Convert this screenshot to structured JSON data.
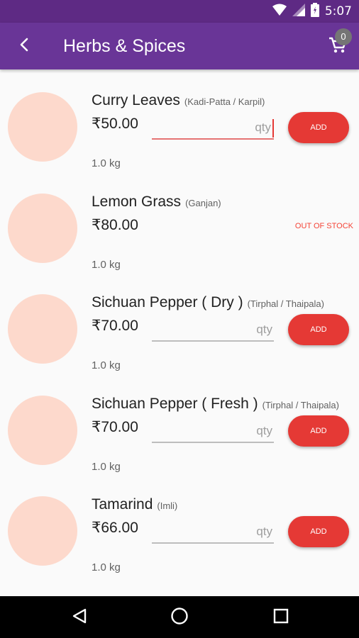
{
  "status_bar": {
    "time": "5:07"
  },
  "app_bar": {
    "title": "Herbs & Spices",
    "cart_count": "0"
  },
  "colors": {
    "primary": "#693597",
    "status_bar": "#5e2a84",
    "accent": "#e53935",
    "thumbnail": "#fdd9cc"
  },
  "qty_placeholder": "qty",
  "add_label": "ADD",
  "out_of_stock_label": "OUT OF STOCK",
  "products": [
    {
      "name": "Curry Leaves",
      "alt_name": "(Kadi-Patta / Karpil)",
      "price": "₹50.00",
      "unit": "1.0 kg",
      "in_stock": true,
      "focused": true
    },
    {
      "name": "Lemon Grass",
      "alt_name": "(Ganjan)",
      "price": "₹80.00",
      "unit": "1.0 kg",
      "in_stock": false,
      "focused": false
    },
    {
      "name": "Sichuan Pepper ( Dry )",
      "alt_name": "(Tirphal / Thaipala)",
      "price": "₹70.00",
      "unit": "1.0 kg",
      "in_stock": true,
      "focused": false
    },
    {
      "name": "Sichuan Pepper ( Fresh )",
      "alt_name": "(Tirphal / Thaipala)",
      "price": "₹70.00",
      "unit": "1.0 kg",
      "in_stock": true,
      "focused": false
    },
    {
      "name": "Tamarind",
      "alt_name": "(Imli)",
      "price": "₹66.00",
      "unit": "1.0 kg",
      "in_stock": true,
      "focused": false
    }
  ],
  "icons": [
    "wifi-icon",
    "signal-icon",
    "battery-icon",
    "back-arrow-icon",
    "cart-icon",
    "nav-back-icon",
    "nav-home-icon",
    "nav-recents-icon"
  ]
}
